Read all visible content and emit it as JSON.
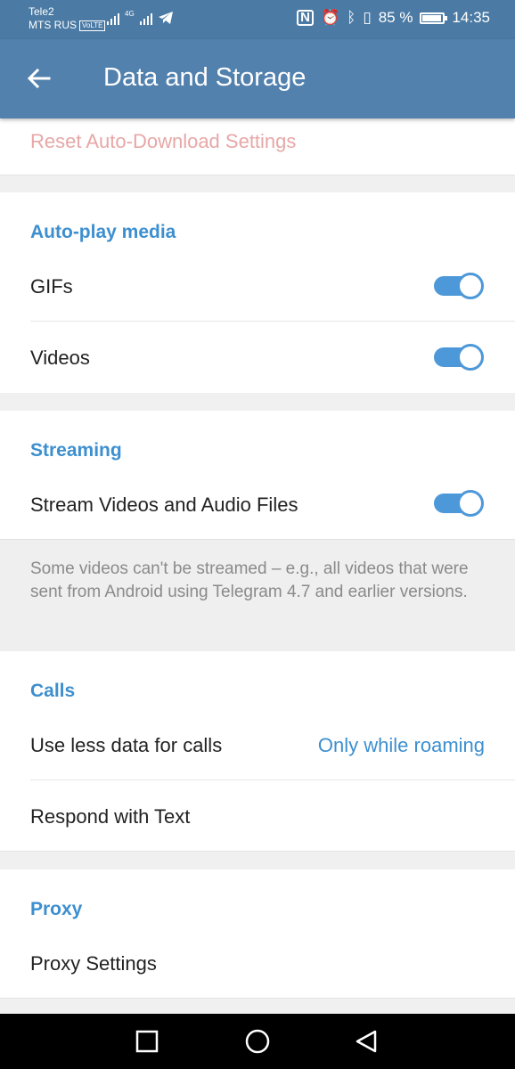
{
  "status": {
    "carrier1": "Tele2",
    "carrier2": "MTS RUS",
    "volte": "VoLTE",
    "net": "4G",
    "battery": "85 %",
    "time": "14:35"
  },
  "appbar": {
    "title": "Data and Storage",
    "back_icon": "arrow-left-icon"
  },
  "reset": {
    "label": "Reset Auto-Download Settings"
  },
  "autoplay": {
    "header": "Auto-play media",
    "items": [
      {
        "label": "GIFs",
        "on": true
      },
      {
        "label": "Videos",
        "on": true
      }
    ]
  },
  "streaming": {
    "header": "Streaming",
    "item": {
      "label": "Stream Videos and Audio Files",
      "on": true
    },
    "note": "Some videos can't be streamed – e.g., all videos that were sent from Android using Telegram 4.7 and earlier versions."
  },
  "calls": {
    "header": "Calls",
    "less_data": {
      "label": "Use less data for calls",
      "value": "Only while roaming"
    },
    "respond": {
      "label": "Respond with Text"
    }
  },
  "proxy": {
    "header": "Proxy",
    "settings": {
      "label": "Proxy Settings"
    }
  },
  "colors": {
    "accent": "#3d8fcf",
    "appbar": "#5281ae",
    "reset": "#e7a7a7"
  }
}
